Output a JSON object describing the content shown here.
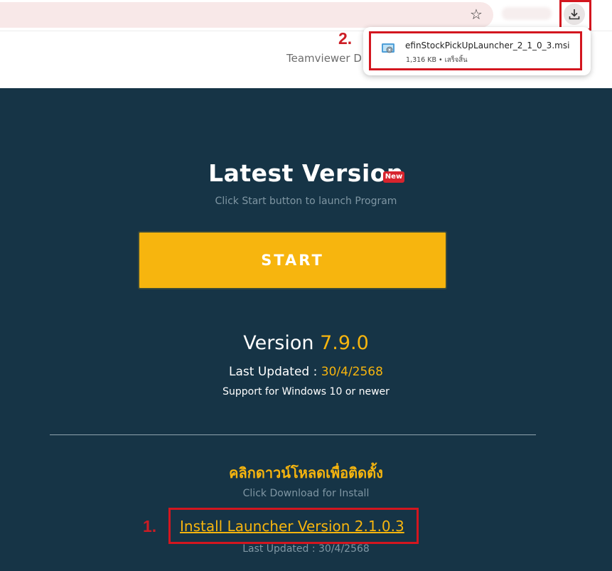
{
  "browser": {
    "star_icon": "star-icon",
    "download_icon": "download-tray-icon"
  },
  "page_top": {
    "teamviewer_text": "Teamviewer D"
  },
  "download_popup": {
    "step_label": "2.",
    "file_name": "efinStockPickUpLauncher_2_1_0_3.msi",
    "file_meta": "1,316 KB • เสร็จสิ้น",
    "file_icon": "msi-installer-icon"
  },
  "main": {
    "title": "Latest Version",
    "new_badge": "New",
    "subtitle": "Click Start button to launch Program",
    "start_label": "START",
    "version_prefix": "Version ",
    "version_number": "7.9.0",
    "last_updated_label": "Last Updated : ",
    "last_updated_date": "30/4/2568",
    "support_text": "Support for Windows 10 or newer",
    "download_heading": "คลิกดาวน์โหลดเพื่อติดตั้ง",
    "download_sub": "Click Download for Install",
    "step1_label": "1.",
    "install_link": "Install Launcher Version 2.1.0.3",
    "install_last_updated": "Last Updated : 30/4/2568"
  },
  "colors": {
    "dark_bg": "#163446",
    "accent_yellow": "#f7b50e",
    "highlight_red": "#d3161f"
  }
}
